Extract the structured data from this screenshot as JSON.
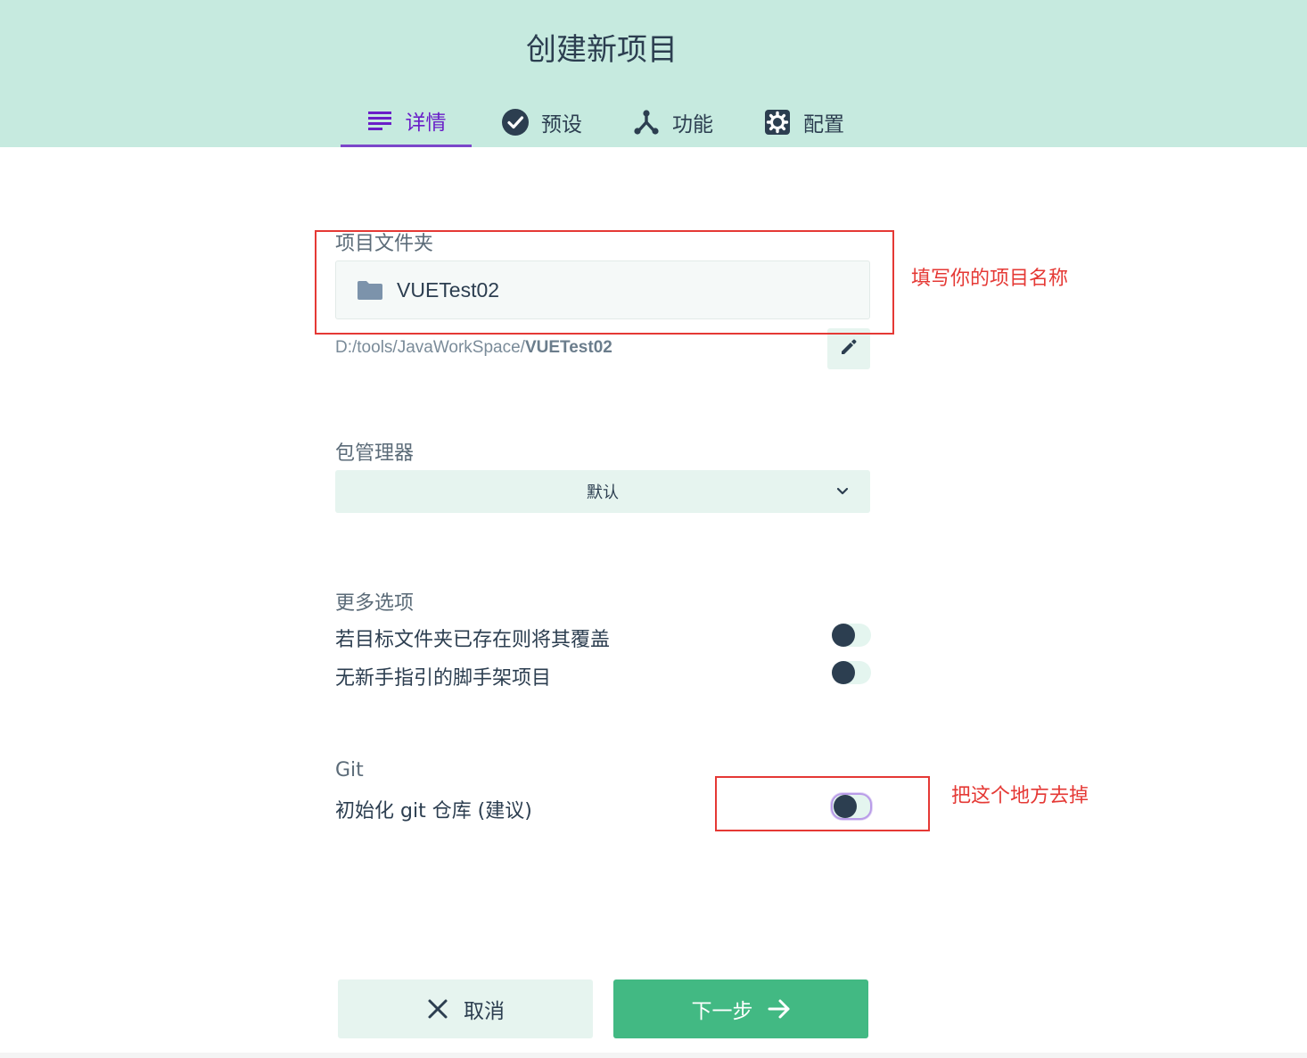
{
  "window_title": "创建新项目",
  "tabs": [
    {
      "label": "详情",
      "icon": "list-icon",
      "active": true
    },
    {
      "label": "预设",
      "icon": "check-circle-icon",
      "active": false
    },
    {
      "label": "功能",
      "icon": "fork-icon",
      "active": false
    },
    {
      "label": "配置",
      "icon": "gear-icon",
      "active": false
    }
  ],
  "project_folder": {
    "label": "项目文件夹",
    "value": "VUETest02",
    "path_prefix": "D:/tools/JavaWorkSpace/",
    "path_name": "VUETest02"
  },
  "package_manager": {
    "label": "包管理器",
    "selected": "默认"
  },
  "more_options": {
    "label": "更多选项",
    "items": [
      {
        "text": "若目标文件夹已存在则将其覆盖",
        "enabled": false
      },
      {
        "text": "无新手指引的脚手架项目",
        "enabled": false
      }
    ]
  },
  "git": {
    "label": "Git",
    "init_text": "初始化 git 仓库 (建议)",
    "enabled": false
  },
  "annotations": {
    "name_note": "填写你的项目名称",
    "git_note": "把这个地方去掉"
  },
  "buttons": {
    "cancel": "取消",
    "next": "下一步"
  },
  "colors": {
    "header_bg": "#c6eadf",
    "accent": "#42b983",
    "active_tab": "#6a1fc8",
    "annotation": "#e53935"
  }
}
